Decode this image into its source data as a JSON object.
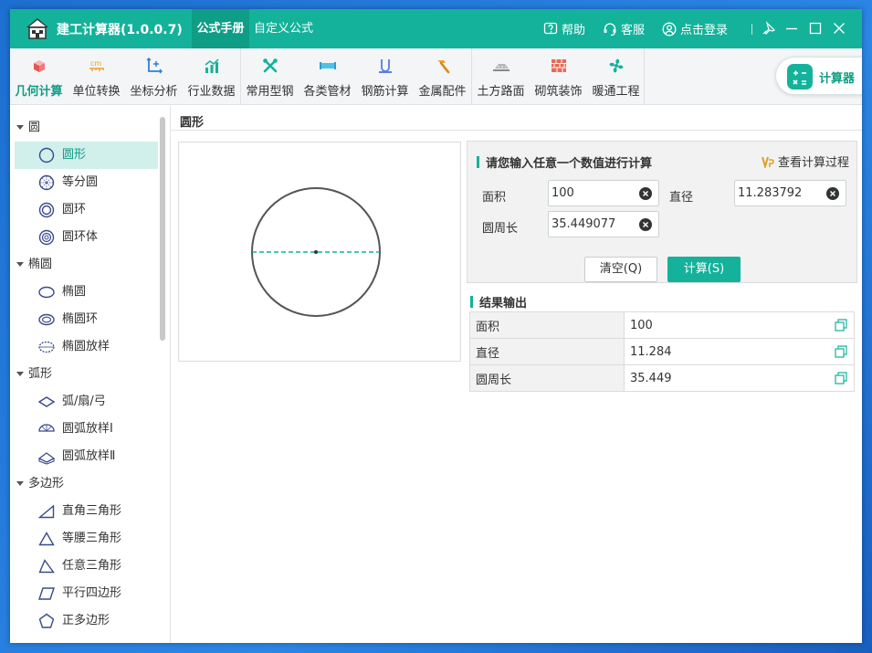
{
  "titlebar": {
    "app_title": "建工计算器(1.0.0.7)",
    "tabs": [
      "公式手册",
      "自定义公式"
    ],
    "help": "帮助",
    "service": "客服",
    "login": "点击登录"
  },
  "toolbar": {
    "items": [
      "几何计算",
      "单位转换",
      "坐标分析",
      "行业数据",
      "常用型钢",
      "各类管材",
      "钢筋计算",
      "金属配件",
      "土方路面",
      "砌筑装饰",
      "暖通工程"
    ],
    "calculator": "计算器"
  },
  "sidebar": {
    "groups": [
      "圆",
      "椭圆",
      "弧形",
      "多边形"
    ],
    "items": [
      "圆形",
      "等分圆",
      "圆环",
      "圆环体",
      "椭圆",
      "椭圆环",
      "椭圆放样",
      "弧/扇/弓",
      "圆弧放样Ⅰ",
      "圆弧放样Ⅱ",
      "直角三角形",
      "等腰三角形",
      "任意三角形",
      "平行四边形",
      "正多边形"
    ]
  },
  "main": {
    "title": "圆形",
    "input_heading": "请您输入任意一个数值进行计算",
    "view_process": "查看计算过程",
    "fields": {
      "area_label": "面积",
      "area_value": "100",
      "diameter_label": "直径",
      "diameter_value": "11.283792",
      "circumference_label": "圆周长",
      "circumference_value": "35.449077"
    },
    "clear_button": "清空(Q)",
    "calc_button": "计算(S)",
    "result_heading": "结果输出",
    "results": [
      {
        "key": "面积",
        "value": "100"
      },
      {
        "key": "直径",
        "value": "11.284"
      },
      {
        "key": "圆周长",
        "value": "35.449"
      }
    ]
  },
  "colors": {
    "accent": "#14b29a",
    "accent_dark": "#0e9d86",
    "diagram_line": "#14b29a"
  }
}
